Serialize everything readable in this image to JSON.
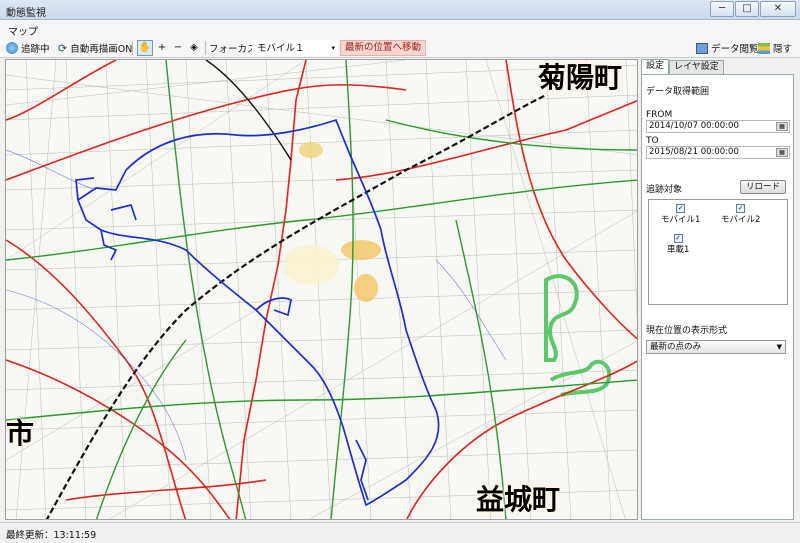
{
  "window": {
    "title": "動態監視",
    "min_glyph": "─",
    "max_glyph": "□",
    "close_glyph": "✕"
  },
  "menu": {
    "map": "マップ"
  },
  "toolbar": {
    "tracking": "追跡中",
    "auto_redraw": "自動再描画ON",
    "focus_label": "フォーカス",
    "focus_value": "モバイル１",
    "move_latest": "最新の位置へ移動",
    "data_view": "データ閲覧",
    "hide": "隠す",
    "pan_glyph": "✋",
    "zoom_in_glyph": "+",
    "zoom_out_glyph": "−",
    "measure_glyph": "◈",
    "reload_glyph": "⟳",
    "combo_arrow": "▾",
    "icons": [
      "tracking-icon",
      "reload-icon",
      "pan-tool-icon",
      "zoom-in-icon",
      "zoom-out-icon",
      "measure-icon",
      "data-view-icon",
      "layers-icon"
    ]
  },
  "map": {
    "labels": [
      {
        "id": "kikuyo",
        "text": "菊陽町"
      },
      {
        "id": "shi",
        "text": "市"
      },
      {
        "id": "mashiki",
        "text": "益城町"
      }
    ]
  },
  "panel": {
    "tabs": [
      "設定",
      "レイヤ設定"
    ],
    "range_title": "データ取得範囲",
    "from_label": "FROM",
    "from_value": "2014/10/07 00:00:00",
    "to_label": "TO",
    "to_value": "2015/08/21 00:00:00",
    "targets_label": "追跡対象",
    "reload": "リロード",
    "targets": [
      {
        "label": "モバイル1",
        "checked": true
      },
      {
        "label": "モバイル2",
        "checked": true
      },
      {
        "label": "車載1",
        "checked": true
      }
    ],
    "check_glyph": "✓",
    "cal_glyph": "▦",
    "display_format_label": "現在位置の表示形式",
    "display_format_value": "最新の点のみ",
    "select_arrow": "▼"
  },
  "status": {
    "last_update": "最終更新：13:11:59"
  },
  "colors": {
    "accent": "#2c7cc4",
    "route": "#1a2fd0",
    "road_red": "#e0231c",
    "road_green": "#2a9a2a",
    "railway": "#111111"
  }
}
